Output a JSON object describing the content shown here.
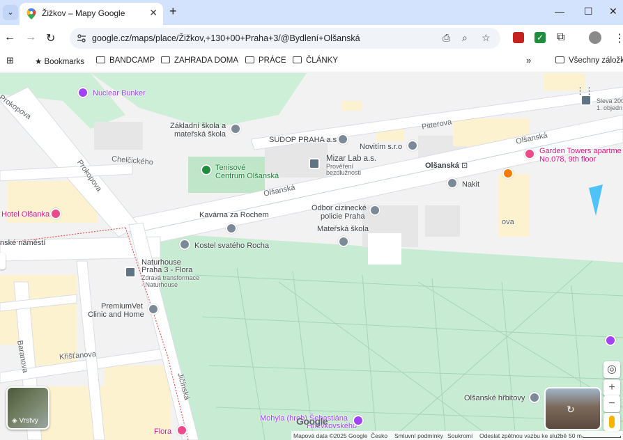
{
  "browser": {
    "tab_title": "Žižkov – Mapy Google",
    "url": "google.cz/maps/place/Žižkov,+130+00+Praha+3/@Bydlení+Olšanská",
    "bookmarks": [
      "Bookmarks",
      "BANDCAMP",
      "ZAHRADA DOMA",
      "PRÁCE",
      "ČLÁNKY"
    ],
    "other_bookmarks": "Všechny záložky",
    "overflow": "»"
  },
  "map": {
    "places": {
      "nuclear_bunker": "Nuclear Bunker",
      "zakladni_skola_1": "Základní škola a",
      "zakladni_skola_2": "mateřská škola",
      "sudop": "SUDOP PRAHA a.s",
      "novitim": "Novitím s.r.o",
      "mizar_1": "Mizar Lab a.s.",
      "mizar_2": "Prověření",
      "mizar_3": "bezdlužnosti",
      "olsanska_stop": "Olšanská",
      "tenis_1": "Tenisové",
      "tenis_2": "Centrum Olšanská",
      "nakit": "Nakit",
      "garden_1": "Garden Towers apartme",
      "garden_2": "No.078, 9th floor",
      "hotel": "Hotel Olšanka",
      "kavarna": "Kavárna za Rochem",
      "odbor_1": "Odbor cizinecké",
      "odbor_2": "policie Praha",
      "materska": "Mateřská škola",
      "kostel": "Kostel svatého Rocha",
      "nat_1": "Naturhouse",
      "nat_2": "Praha 3 - Flora",
      "nat_3": "Zdravá transformace",
      "nat_4": "- Naturhouse",
      "premium_1": "PremiumVet",
      "premium_2": "Clinic and Home",
      "hrbitovy": "Olšanské hřbitovy",
      "mohyla_1": "Mohyla (hrob) Šebastiána",
      "mohyla_2": "Hněvkovského",
      "flora": "Flora",
      "top_right_1": "Sleva 200",
      "top_right_2": "1. objedn"
    },
    "streets": {
      "prokopova": "Prokopova",
      "prokopova2": "Prokopova",
      "chelcickeho": "Chelčického",
      "pitterova": "Pitterova",
      "olsanska_1": "Olšanská",
      "olsanska_2": "Olšanská",
      "olsanska_3": "Olšanská",
      "namesti": "nské náměstí",
      "baranova": "Baranova",
      "kristanova": "Křišťanova",
      "jicinska": "Jičínská",
      "ova": "ova"
    },
    "layers_label": "Vrstvy",
    "logo": "Google",
    "footer": [
      "Mapová data ©2025 Google",
      "Česko",
      "Smluvní podmínky",
      "Soukromí",
      "Odeslat zpětnou vazbu ke službě",
      "50 m"
    ]
  }
}
